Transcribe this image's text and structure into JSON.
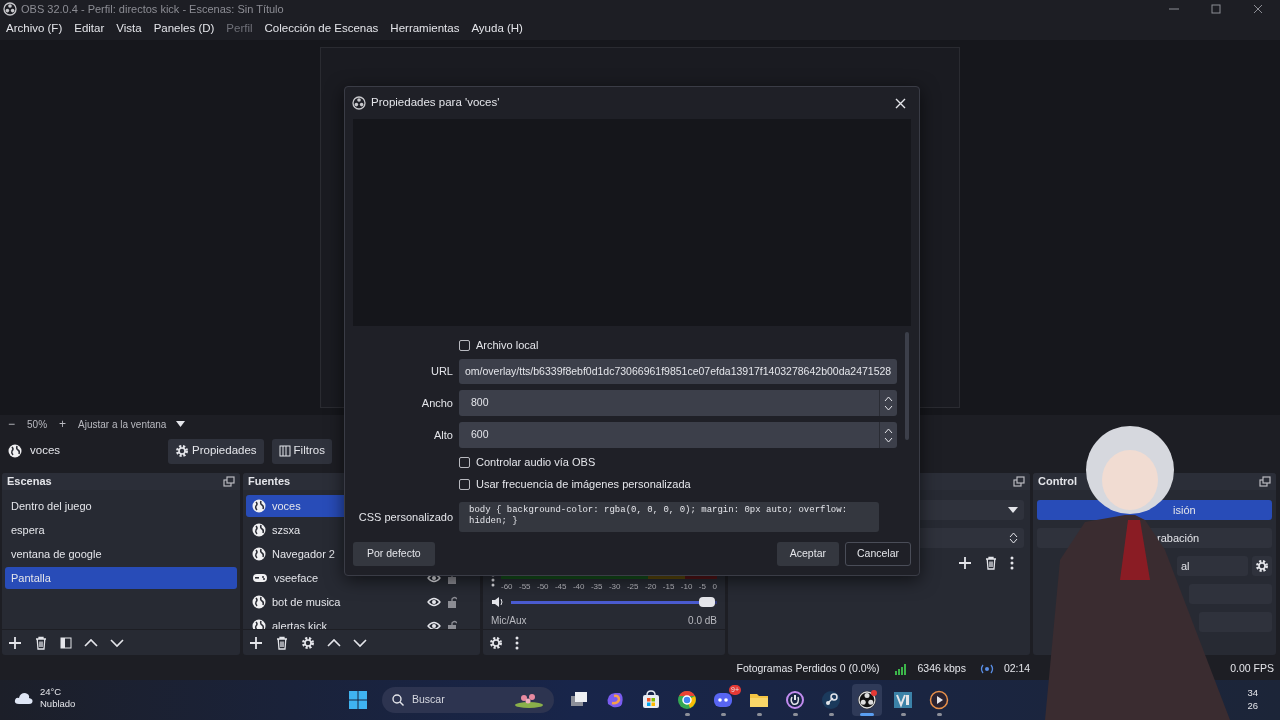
{
  "window": {
    "title": "OBS 32.0.4 - Perfil: directos kick - Escenas: Sin Título"
  },
  "menu": [
    {
      "label": "Archivo (F)",
      "disabled": false
    },
    {
      "label": "Editar",
      "disabled": false
    },
    {
      "label": "Vista",
      "disabled": false
    },
    {
      "label": "Paneles (D)",
      "disabled": false
    },
    {
      "label": "Perfil",
      "disabled": true
    },
    {
      "label": "Colección de Escenas",
      "disabled": false
    },
    {
      "label": "Herramientas",
      "disabled": false
    },
    {
      "label": "Ayuda (H)",
      "disabled": false
    }
  ],
  "zoom_bar": {
    "zoom_out": "−",
    "zoom": "50%",
    "zoom_in": "+",
    "fit": "Ajustar a la ventana"
  },
  "source_toolbar": {
    "source": "voces",
    "buttons": [
      {
        "kind": "properties",
        "label": "Propiedades"
      },
      {
        "kind": "filters",
        "label": "Filtros"
      }
    ]
  },
  "scenes": {
    "title": "Escenas",
    "items": [
      {
        "label": "Dentro del juego",
        "selected": false
      },
      {
        "label": "espera",
        "selected": false
      },
      {
        "label": "ventana de google",
        "selected": false
      },
      {
        "label": "Pantalla",
        "selected": true
      }
    ]
  },
  "sources": {
    "title": "Fuentes",
    "items": [
      {
        "label": "voces",
        "kind": "browser",
        "selected": true
      },
      {
        "label": "szsxa",
        "kind": "browser",
        "selected": false
      },
      {
        "label": "Navegador 2",
        "kind": "browser",
        "selected": false
      },
      {
        "label": "vseeface",
        "kind": "game",
        "selected": false,
        "visible": true,
        "locked": false
      },
      {
        "label": "bot de musica",
        "kind": "browser",
        "selected": false,
        "visible": true,
        "locked": false
      },
      {
        "label": "alertas kick",
        "kind": "browser",
        "selected": false,
        "visible": true,
        "locked": false
      }
    ]
  },
  "mixer": {
    "ticks": [
      "-60",
      "-55",
      "-50",
      "-45",
      "-40",
      "-35",
      "-30",
      "-25",
      "-20",
      "-15",
      "-10",
      "-5",
      "0"
    ],
    "level": 0.98,
    "next_channel": "Mic/Aux",
    "next_reading": "0.0 dB"
  },
  "controls": {
    "title": "Control",
    "buttons": [
      {
        "label": "isión",
        "active": true
      },
      {
        "label": "rabación",
        "active": false
      },
      {
        "label": "al",
        "active": false,
        "settings": true
      },
      {
        "active": false
      },
      {
        "active": false
      }
    ]
  },
  "status_bar": {
    "dropped": "Fotogramas Perdidos 0 (0.0%)",
    "bitrate": "6346 kbps",
    "time": "02:14",
    "fps": "0.00 FPS"
  },
  "dialog": {
    "title": "Propiedades para 'voces'",
    "fields": [
      {
        "kind": "checkbox",
        "label": "Archivo local",
        "checked": false
      },
      {
        "kind": "text",
        "label": "URL",
        "value": "om/overlay/tts/b6339f8ebf0d1dc73066961f9851ce07efda13917f1403278642b00da2471528"
      },
      {
        "kind": "spin",
        "label": "Ancho",
        "value": "800"
      },
      {
        "kind": "spin",
        "label": "Alto",
        "value": "600"
      },
      {
        "kind": "checkbox",
        "label": "Controlar audio vía OBS",
        "checked": false
      },
      {
        "kind": "checkbox",
        "label": "Usar frecuencia de imágenes personalizada",
        "checked": false
      },
      {
        "kind": "code",
        "label": "CSS personalizado",
        "value": "body { background-color: rgba(0, 0, 0, 0); margin: 0px auto; overflow: hidden; }"
      }
    ],
    "defaults_button": "Por defecto",
    "ok_button": "Aceptar",
    "cancel_button": "Cancelar"
  },
  "taskbar": {
    "temperature": "24°C",
    "weather": "Nublado",
    "search_placeholder": "Buscar",
    "apps": [
      {
        "kind": "taskview",
        "active": false,
        "open": false
      },
      {
        "kind": "copilot",
        "active": false,
        "open": false
      },
      {
        "kind": "store",
        "active": false,
        "open": false
      },
      {
        "kind": "chrome",
        "active": false,
        "open": true
      },
      {
        "kind": "discord",
        "active": false,
        "open": true,
        "badge": "9+"
      },
      {
        "kind": "folder",
        "active": false,
        "open": true
      },
      {
        "kind": "ring",
        "active": false,
        "open": true
      },
      {
        "kind": "steam",
        "active": false,
        "open": true
      },
      {
        "kind": "obs",
        "active": true,
        "open": true
      },
      {
        "kind": "vapp",
        "active": false,
        "open": true
      },
      {
        "kind": "player",
        "active": false,
        "open": true
      }
    ],
    "clock_time": "34",
    "clock_date": "26"
  }
}
